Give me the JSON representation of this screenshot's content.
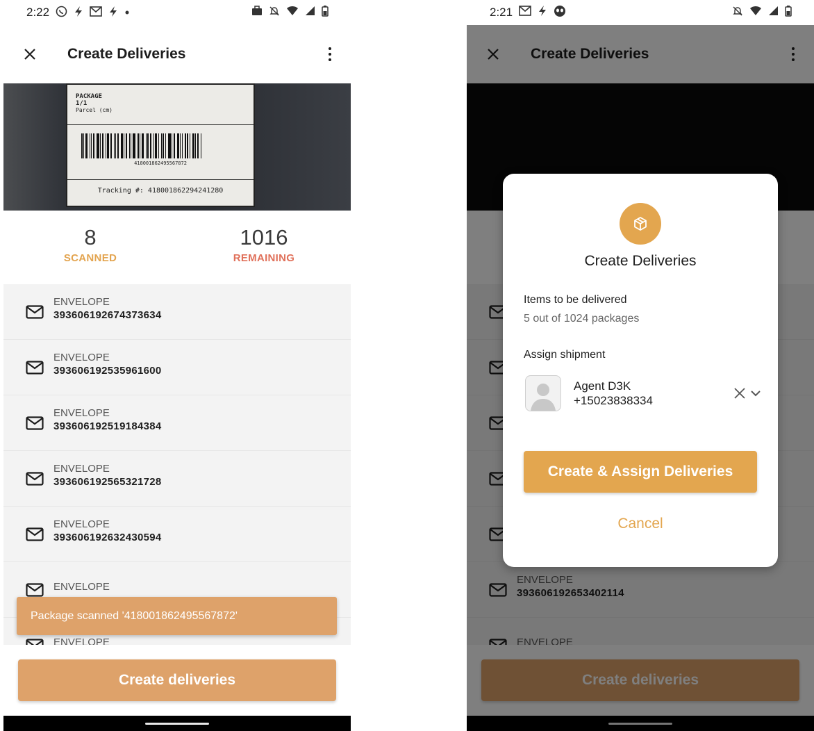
{
  "colors": {
    "accent": "#dea26a",
    "scanned": "#e3a44f",
    "remaining": "#e0705a",
    "dialog_accent": "#e3a64f"
  },
  "left": {
    "status": {
      "time": "2:22",
      "icons": [
        "whatsapp-icon",
        "bolt-icon",
        "gmail-icon",
        "bolt-icon",
        "dot-icon"
      ],
      "right_icons": [
        "briefcase-icon",
        "bell-off-icon",
        "wifi-icon",
        "signal-icon",
        "battery-icon"
      ]
    },
    "appbar": {
      "title": "Create Deliveries"
    },
    "camera": {
      "label_package": "PACKAGE",
      "label_count": "1/1",
      "label_parcel": "Parcel (cm)",
      "barcode_number": "418001862495567872",
      "tracking": "Tracking #: 418001862294241280"
    },
    "counters": {
      "scanned_value": "8",
      "scanned_label": "SCANNED",
      "remaining_value": "1016",
      "remaining_label": "REMAINING"
    },
    "items": [
      {
        "type": "ENVELOPE",
        "code": "393606192674373634"
      },
      {
        "type": "ENVELOPE",
        "code": "393606192535961600"
      },
      {
        "type": "ENVELOPE",
        "code": "393606192519184384"
      },
      {
        "type": "ENVELOPE",
        "code": "393606192565321728"
      },
      {
        "type": "ENVELOPE",
        "code": "393606192632430594"
      },
      {
        "type": "ENVELOPE",
        "code": ""
      },
      {
        "type": "ENVELOPE",
        "code": ""
      }
    ],
    "snackbar": "Package scanned '418001862495567872'",
    "primary_button": "Create deliveries"
  },
  "right": {
    "status": {
      "time": "2:21",
      "icons": [
        "gmail-icon",
        "bolt-icon",
        "alien-icon"
      ],
      "right_icons": [
        "bell-off-icon",
        "wifi-icon",
        "signal-icon",
        "battery-icon"
      ]
    },
    "appbar": {
      "title": "Create Deliveries"
    },
    "items": [
      {
        "type": "",
        "code": ""
      },
      {
        "type": "",
        "code": ""
      },
      {
        "type": "",
        "code": ""
      },
      {
        "type": "",
        "code": ""
      },
      {
        "type": "",
        "code": ""
      },
      {
        "type": "ENVELOPE",
        "code": "393606192653402114"
      },
      {
        "type": "ENVELOPE",
        "code": ""
      }
    ],
    "primary_button": "Create deliveries",
    "dialog": {
      "icon": "package-icon",
      "title": "Create Deliveries",
      "items_label": "Items to be delivered",
      "items_value": "5 out of 1024 packages",
      "assign_label": "Assign shipment",
      "agent_name": "Agent D3K",
      "agent_phone": "+15023838334",
      "confirm_button": "Create & Assign Deliveries",
      "cancel_button": "Cancel"
    }
  }
}
